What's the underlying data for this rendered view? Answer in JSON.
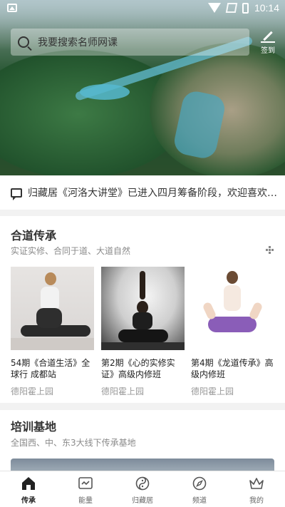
{
  "status_bar": {
    "time": "10:14"
  },
  "search": {
    "placeholder": "我要搜索名师网课"
  },
  "signin": {
    "label": "签到"
  },
  "notice": {
    "text": "归藏居《河洛大讲堂》已进入四月筹备阶段，欢迎喜欢…"
  },
  "section_lineage": {
    "title": "合道传承",
    "subtitle": "实证实修、合同于道、大道自然",
    "cards": [
      {
        "title": "54期《合道生活》全球行 成都站",
        "place": "德阳霍上园"
      },
      {
        "title": "第2期《心的实修实证》高级内修班",
        "place": "德阳霍上园"
      },
      {
        "title": "第4期《龙道传承》高级内修班",
        "place": "德阳霍上园"
      }
    ]
  },
  "section_base": {
    "title": "培训基地",
    "subtitle": "全国西、中、东3大线下传承基地"
  },
  "tabbar": {
    "items": [
      {
        "label": "传承",
        "icon": "home-icon",
        "active": true
      },
      {
        "label": "能量",
        "icon": "energy-icon",
        "active": false
      },
      {
        "label": "归藏居",
        "icon": "taichi-icon",
        "active": false
      },
      {
        "label": "频道",
        "icon": "compass-icon",
        "active": false
      },
      {
        "label": "我的",
        "icon": "crown-icon",
        "active": false
      }
    ]
  },
  "colors": {
    "text": "#333333",
    "muted": "#8a8a8a",
    "background": "#f2f2f2"
  }
}
